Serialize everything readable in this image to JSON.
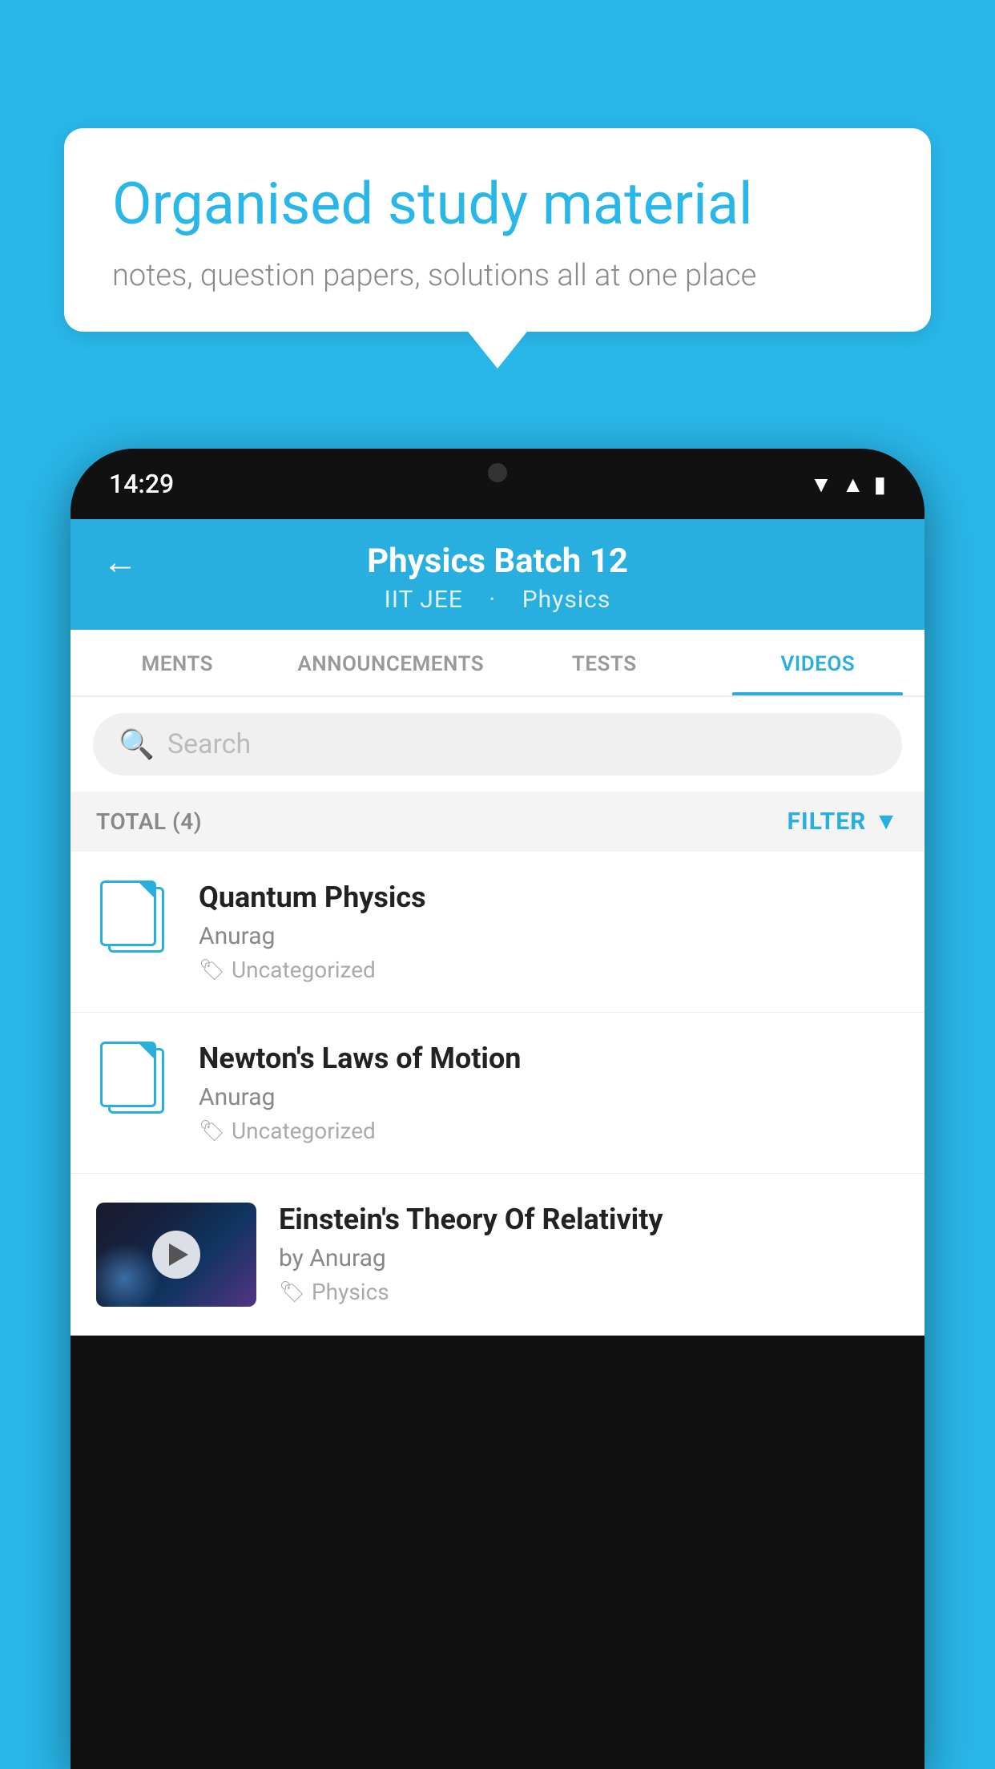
{
  "background": {
    "color": "#29b6e8"
  },
  "speech_bubble": {
    "title": "Organised study material",
    "subtitle": "notes, question papers, solutions all at one place"
  },
  "phone": {
    "status_bar": {
      "time": "14:29"
    },
    "header": {
      "title": "Physics Batch 12",
      "subtitle_part1": "IIT JEE",
      "subtitle_part2": "Physics",
      "back_label": "←"
    },
    "tabs": [
      {
        "label": "MENTS",
        "active": false
      },
      {
        "label": "ANNOUNCEMENTS",
        "active": false
      },
      {
        "label": "TESTS",
        "active": false
      },
      {
        "label": "VIDEOS",
        "active": true
      }
    ],
    "search": {
      "placeholder": "Search"
    },
    "filter_row": {
      "total_label": "TOTAL (4)",
      "filter_label": "FILTER"
    },
    "videos": [
      {
        "title": "Quantum Physics",
        "author": "Anurag",
        "tag": "Uncategorized",
        "has_thumbnail": false
      },
      {
        "title": "Newton's Laws of Motion",
        "author": "Anurag",
        "tag": "Uncategorized",
        "has_thumbnail": false
      },
      {
        "title": "Einstein's Theory Of Relativity",
        "author": "by Anurag",
        "tag": "Physics",
        "has_thumbnail": true
      }
    ]
  }
}
